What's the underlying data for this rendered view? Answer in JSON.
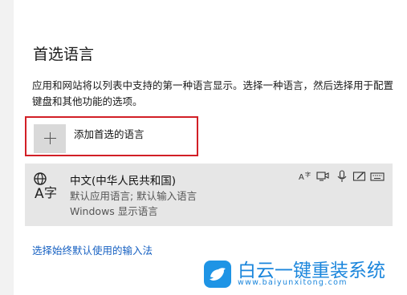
{
  "section": {
    "heading": "首选语言",
    "description": "应用和网站将以列表中支持的第一种语言显示。选择一种语言，然后选择用于配置键盘和其他功能的选项。"
  },
  "add_language": {
    "label": "添加首选的语言",
    "icon": "plus-icon"
  },
  "language": {
    "name": "中文(中华人民共和国)",
    "line1": "默认应用语言; 默认输入语言",
    "line2": "Windows 显示语言",
    "feature_icons": [
      "text-to-speech-icon",
      "display-language-icon",
      "microphone-icon",
      "handwriting-icon",
      "keyboard-icon"
    ]
  },
  "link": {
    "label": "选择始终默认使用的输入法"
  },
  "watermark": {
    "title": "白云一键重装系统",
    "url": "www.baiyunxitong.com"
  }
}
